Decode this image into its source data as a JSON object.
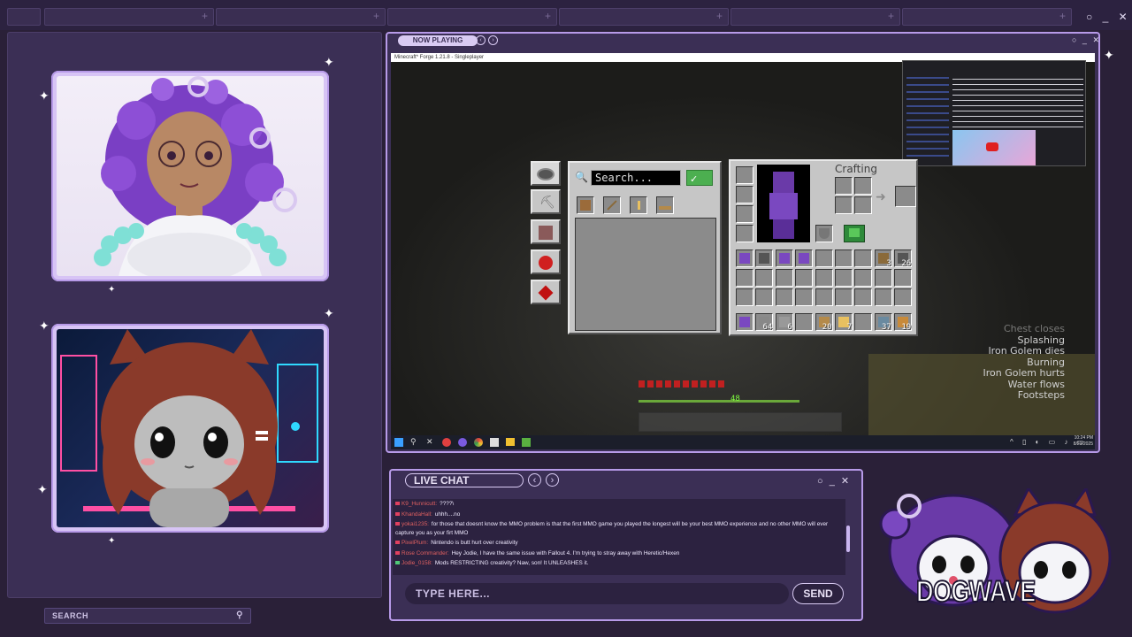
{
  "top_bar": {
    "window_controls": "○ _ ✕"
  },
  "left_panel": {
    "search_label": "SEARCH"
  },
  "now_playing": {
    "title": "NOW PLAYING",
    "prev": "‹",
    "next": "›",
    "window_controls": "○ _ ✕",
    "game_window_title": "Minecraft* Forge 1.21.8 - Singleplayer"
  },
  "game": {
    "creative_search_placeholder": "Search...",
    "crafting_label": "Crafting",
    "creative_tabs": [
      "compass",
      "tools",
      "redstone",
      "food",
      "dust"
    ],
    "hotbar_counts": [
      "64",
      "6",
      "",
      "20",
      "7",
      "",
      "37",
      "19"
    ],
    "main_counts": [
      "",
      "",
      "",
      "",
      "",
      "",
      "",
      "3",
      "26"
    ],
    "subtitles": [
      "Chest closes",
      "Splashing",
      "Iron Golem dies",
      "Burning",
      "Iron Golem hurts",
      "Water flows",
      "Footsteps"
    ],
    "hud_numbers": [
      "48"
    ],
    "taskbar_time": "10:24 PM",
    "taskbar_date": "8/23/2025"
  },
  "chat": {
    "title": "LIVE CHAT",
    "prev": "‹",
    "next": "›",
    "window_controls": "○ _ ✕",
    "messages": [
      {
        "user": "K9_Hunnicutt",
        "text": "????\\",
        "user_color": "#e06060"
      },
      {
        "user": "KhandaHall",
        "text": "uhhh....no",
        "user_color": "#e06060"
      },
      {
        "user": "yokai1235",
        "text": "for those that doesnt know the MMO problem is that the first MMO game you played the longest will be your best MMO experience and no other MMO will ever capture you as your firt MMO",
        "user_color": "#e06060"
      },
      {
        "user": "PixelPlum",
        "text": "Nintendo is butt hurt over creativity",
        "user_color": "#e06060"
      },
      {
        "user": "Rose Commander",
        "text": "Hey Jodie, I have the same issue with Fallout 4. I'm trying to stray away with Heretic/Hexen",
        "user_color": "#e06060"
      },
      {
        "user": "Jodie_0158",
        "text": "Mods RESTRICTING creativity? Naw, son! It UNLEASHES it.",
        "user_color": "#e06060"
      }
    ],
    "input_placeholder": "TYPE HERE...",
    "send_label": "SEND"
  },
  "branding": {
    "logo_text": "DOGWAVE"
  },
  "colors": {
    "accent": "#b79ae8",
    "panel": "#3b2f55",
    "background": "#2a2038"
  }
}
